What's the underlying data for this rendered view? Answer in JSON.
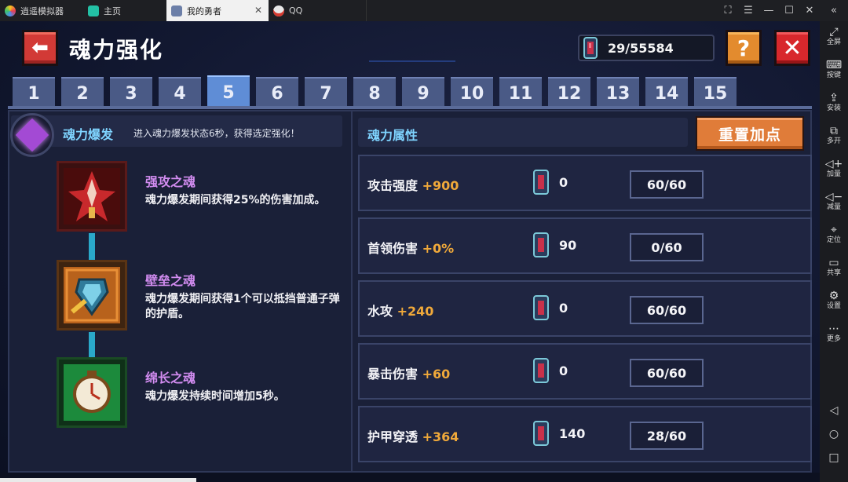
{
  "emulator": {
    "tabs": [
      {
        "label": "逍遥模拟器",
        "icon": "emulator-logo-icon"
      },
      {
        "label": "主页",
        "icon": "home-icon"
      },
      {
        "label": "我的勇者",
        "icon": "game-icon"
      },
      {
        "label": "QQ",
        "icon": "qq-icon"
      }
    ],
    "sidebar": [
      {
        "label": "全屏",
        "icon": "fullscreen-icon"
      },
      {
        "label": "按键",
        "icon": "keyboard-icon"
      },
      {
        "label": "安装",
        "icon": "install-icon"
      },
      {
        "label": "多开",
        "icon": "multi-instance-icon"
      },
      {
        "label": "加量",
        "icon": "volume-up-icon"
      },
      {
        "label": "减量",
        "icon": "volume-down-icon"
      },
      {
        "label": "定位",
        "icon": "location-icon"
      },
      {
        "label": "共享",
        "icon": "folder-icon"
      },
      {
        "label": "设置",
        "icon": "settings-icon"
      },
      {
        "label": "更多",
        "icon": "more-icon"
      }
    ]
  },
  "game": {
    "title": "魂力强化",
    "currency": "29/55584",
    "help_label": "?",
    "close_label": "✕",
    "tabs": [
      "1",
      "2",
      "3",
      "4",
      "5",
      "6",
      "7",
      "8",
      "9",
      "10",
      "11",
      "12",
      "13",
      "14",
      "15"
    ],
    "active_tab": "5",
    "burst": {
      "title": "魂力爆发",
      "desc": "进入魂力爆发状态6秒，获得选定强化！"
    },
    "souls": [
      {
        "name": "强攻之魂",
        "desc": "魂力爆发期间获得25%的伤害加成。"
      },
      {
        "name": "壁垒之魂",
        "desc": "魂力爆发期间获得1个可以抵挡普通子弹的护盾。"
      },
      {
        "name": "绵长之魂",
        "desc": "魂力爆发持续时间增加5秒。"
      }
    ],
    "attributes_title": "魂力属性",
    "reset_label": "重置加点",
    "attributes": [
      {
        "name": "攻击强度",
        "bonus": "+900",
        "cost": "0",
        "level": "60/60"
      },
      {
        "name": "首领伤害",
        "bonus": "+0%",
        "cost": "90",
        "level": "0/60"
      },
      {
        "name": "水攻",
        "bonus": "+240",
        "cost": "0",
        "level": "60/60"
      },
      {
        "name": "暴击伤害",
        "bonus": "+60",
        "cost": "0",
        "level": "60/60"
      },
      {
        "name": "护甲穿透",
        "bonus": "+364",
        "cost": "140",
        "level": "28/60"
      }
    ],
    "colors": {
      "accent_blue": "#7fd4ff",
      "soul_name": "#d28cf0",
      "bonus": "#f0a93a",
      "active_tab": "#5f8dd6"
    }
  }
}
